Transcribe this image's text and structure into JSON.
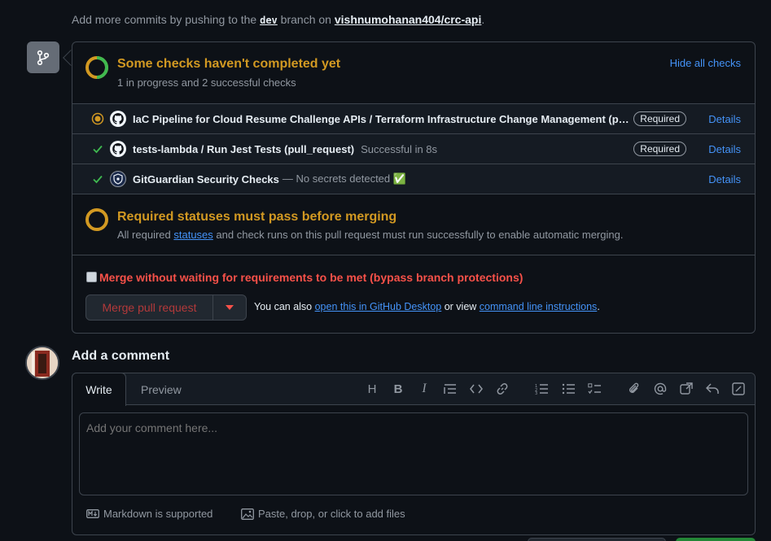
{
  "push_notice": {
    "prefix": "Add more commits by pushing to the ",
    "branch": "dev",
    "middle": " branch on ",
    "repo": "vishnumohanan404/crc-api",
    "suffix": "."
  },
  "checks": {
    "title": "Some checks haven't completed yet",
    "subtitle": "1 in progress and 2 successful checks",
    "hide_label": "Hide all checks",
    "items": [
      {
        "name": "IaC Pipeline for Cloud Resume Challenge APIs / Terraform Infrastructure Change Management (pull_request)",
        "desc": "",
        "badge": "Required",
        "details": "Details",
        "status": "in-progress"
      },
      {
        "name": "tests-lambda / Run Jest Tests (pull_request)",
        "desc": "Successful in 8s",
        "badge": "Required",
        "details": "Details",
        "status": "success"
      },
      {
        "name": "GitGuardian Security Checks",
        "desc": "— No secrets detected ✅",
        "badge": "",
        "details": "Details",
        "status": "success"
      }
    ]
  },
  "required": {
    "title": "Required statuses must pass before merging",
    "text_before": "All required ",
    "link": "statuses",
    "text_after": " and check runs on this pull request must run successfully to enable automatic merging."
  },
  "bypass": {
    "label": "Merge without waiting for requirements to be met (bypass branch protections)",
    "checked": false
  },
  "merge": {
    "button_label": "Merge pull request",
    "also_text": "You can also ",
    "desktop_link": "open this in GitHub Desktop",
    "or_view": " or view ",
    "cli_link": "command line instructions",
    "end": "."
  },
  "comment": {
    "title": "Add a comment",
    "tab_write": "Write",
    "tab_preview": "Preview",
    "placeholder": "Add your comment here...",
    "markdown_label": "Markdown is supported",
    "files_label": "Paste, drop, or click to add files"
  },
  "colors": {
    "background": "#0d1117",
    "warning": "#d29922",
    "success": "#3fb950",
    "link": "#4493f8",
    "danger": "#f85149"
  }
}
